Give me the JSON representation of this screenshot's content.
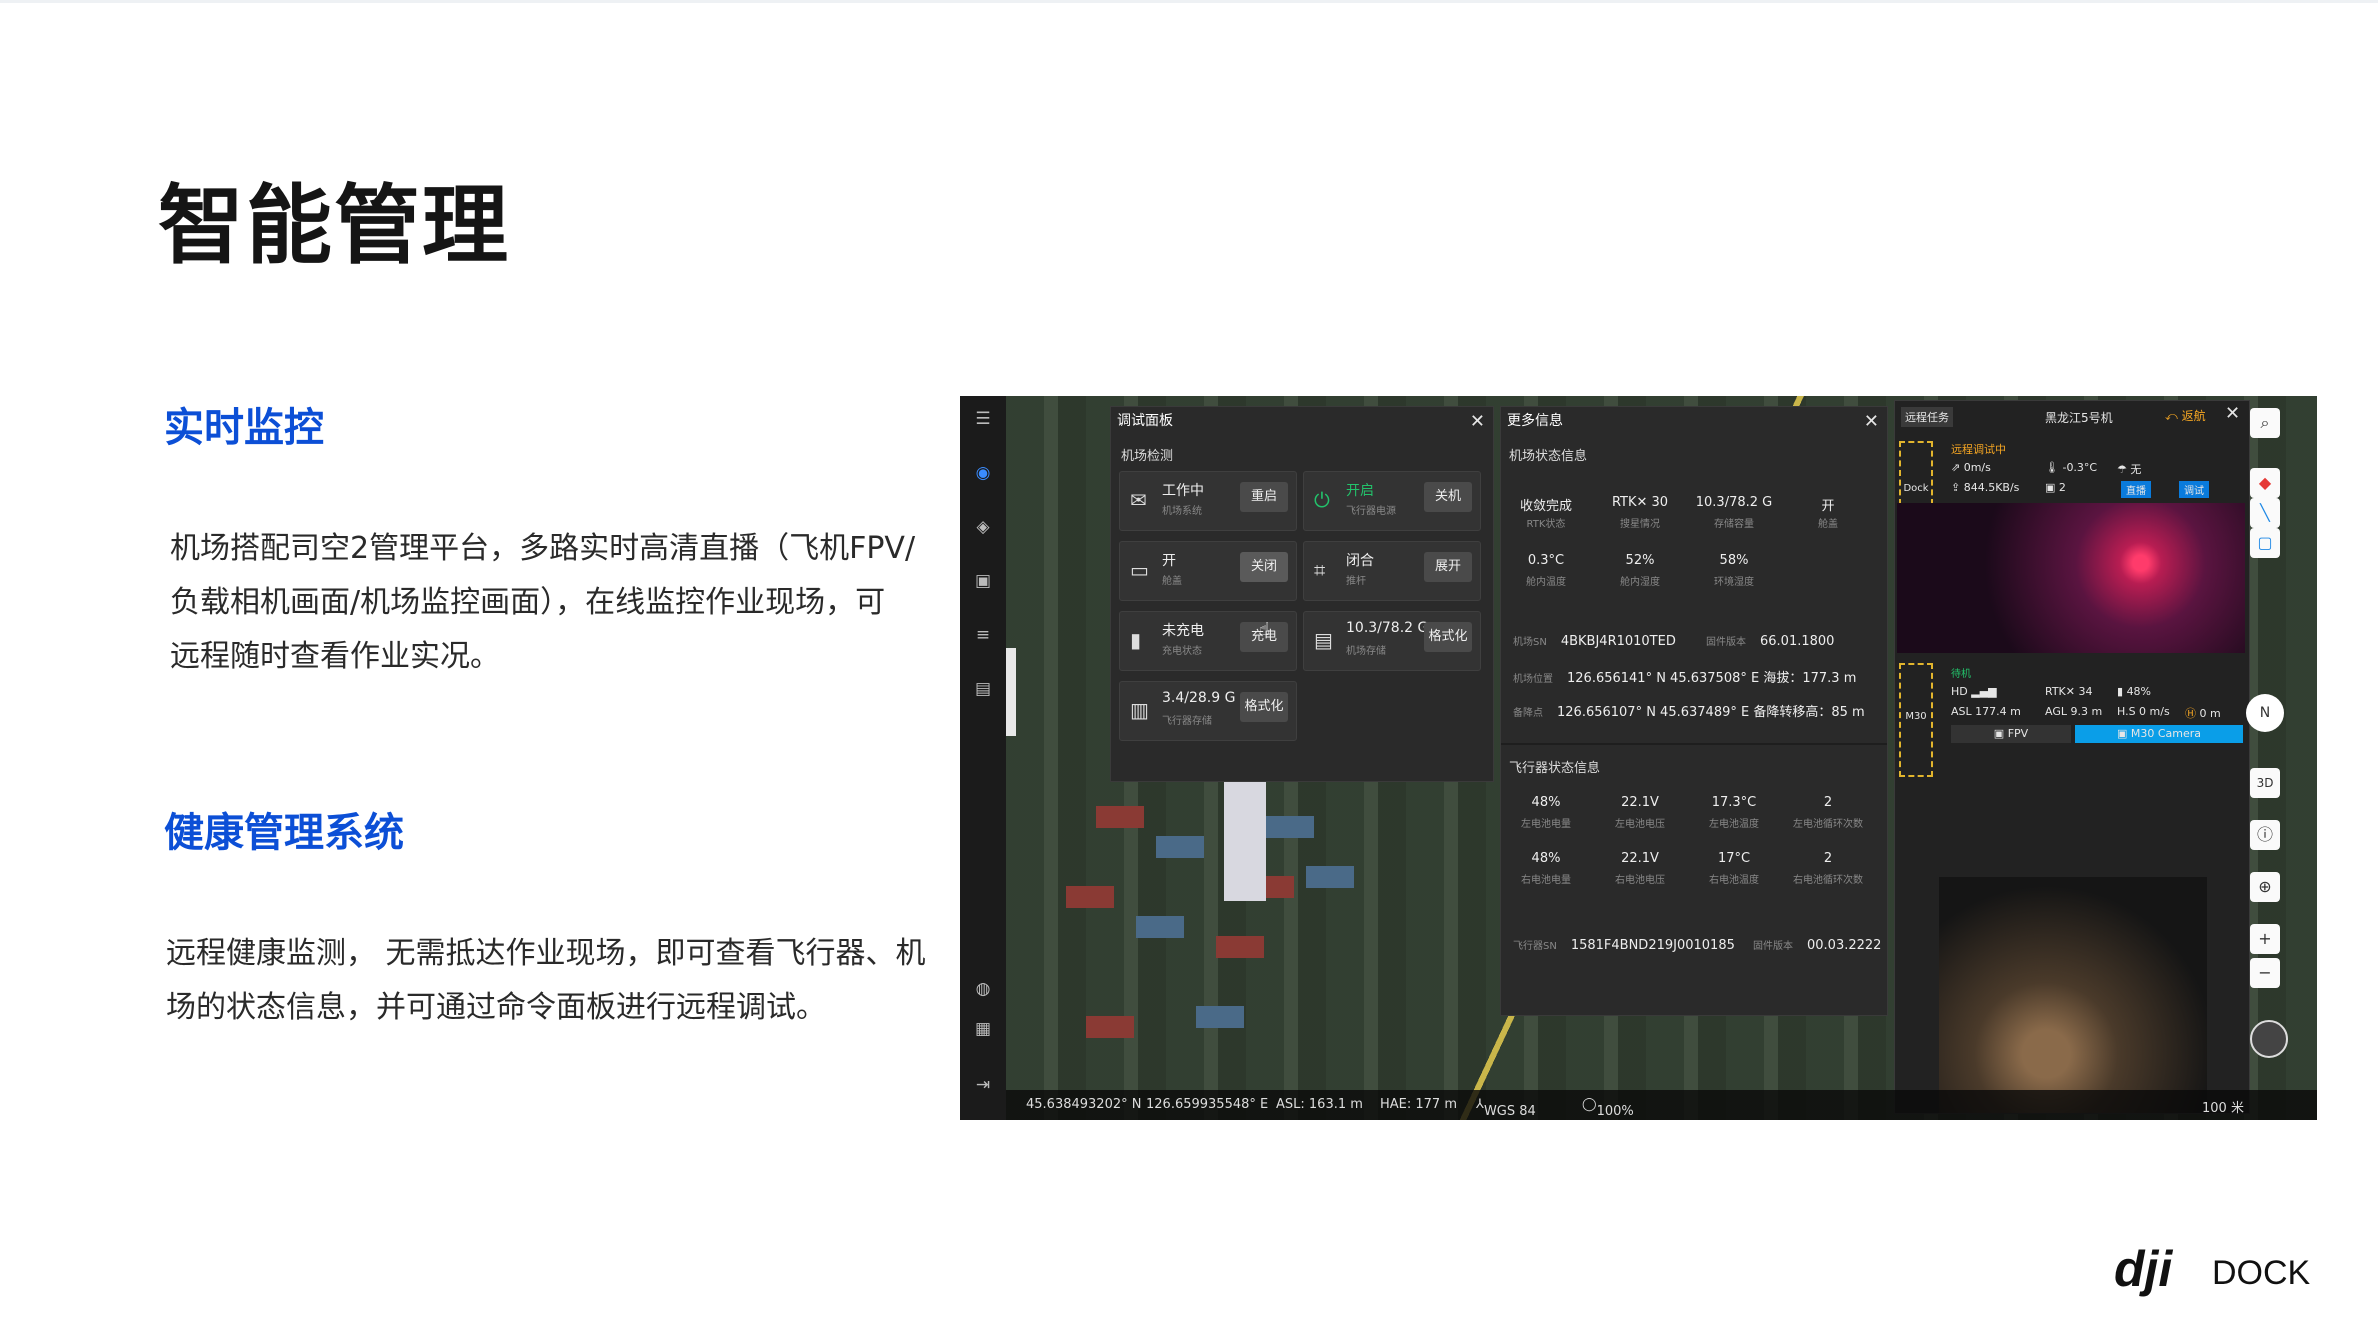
{
  "slide": {
    "title": "智能管理",
    "section1": {
      "heading": "实时监控",
      "lines": [
        "机场搭配司空2管理平台，多路实时高清直播（飞机FPV/",
        "负载相机画面/机场监控画面），在线监控作业现场，可",
        "远程随时查看作业实况。"
      ]
    },
    "section2": {
      "heading": "健康管理系统",
      "lines": [
        "远程健康监测， 无需抵达作业现场，即可查看飞行器、机",
        "场的状态信息，并可通过命令面板进行远程调试。"
      ]
    },
    "logo": {
      "brand": "dji",
      "product": "DOCK"
    }
  },
  "app": {
    "debug_panel": {
      "title": "调试面板",
      "section": "机场检测",
      "cells": [
        {
          "value": "工作中",
          "sub": "机场系统",
          "button": "重启",
          "icon": "mail-icon"
        },
        {
          "value": "开启",
          "sub": "飞行器电源",
          "button": "关机",
          "icon": "power-icon"
        },
        {
          "value": "开",
          "sub": "舱盖",
          "button": "关闭",
          "icon": "cover-icon"
        },
        {
          "value": "闭合",
          "sub": "推杆",
          "button": "展开",
          "icon": "putter-icon"
        },
        {
          "value": "未充电",
          "sub": "充电状态",
          "button": "充电",
          "icon": "battery-icon"
        },
        {
          "value": "10.3/78.2 G",
          "sub": "机场存储",
          "button": "格式化",
          "icon": "storage-icon"
        },
        {
          "value": "3.4/28.9 G",
          "sub": "飞行器存储",
          "button": "格式化",
          "icon": "aircraft-storage-icon"
        }
      ]
    },
    "more_info": {
      "title": "更多信息",
      "dock_section": "机场状态信息",
      "dock_values": [
        {
          "v": "收敛完成",
          "l": "RTK状态"
        },
        {
          "v": "RTK✕ 30",
          "l": "搜星情况"
        },
        {
          "v": "10.3/78.2 G",
          "l": "存储容量"
        },
        {
          "v": "开",
          "l": "舱盖"
        },
        {
          "v": "0.3°C",
          "l": "舱内温度"
        },
        {
          "v": "52%",
          "l": "舱内湿度"
        },
        {
          "v": "58%",
          "l": "环境湿度"
        }
      ],
      "dock_sn_label": "机场SN",
      "dock_sn": "4BKBJ4R1010TED",
      "fw_label": "固件版本",
      "fw": "66.01.1800",
      "pos_label": "机场位置",
      "pos": "126.656141° N  45.637508° E  海拔：177.3 m",
      "alt_label": "备降点",
      "alt": "126.656107° N  45.637489° E  备降转移高：85 m",
      "aircraft_section": "飞行器状态信息",
      "aircraft_values": [
        {
          "v": "48%",
          "l": "左电池电量"
        },
        {
          "v": "22.1V",
          "l": "左电池电压"
        },
        {
          "v": "17.3°C",
          "l": "左电池温度"
        },
        {
          "v": "2",
          "l": "左电池循环次数"
        },
        {
          "v": "48%",
          "l": "右电池电量"
        },
        {
          "v": "22.1V",
          "l": "右电池电压"
        },
        {
          "v": "17°C",
          "l": "右电池温度"
        },
        {
          "v": "2",
          "l": "右电池循环次数"
        }
      ],
      "aircraft_sn_label": "飞行器SN",
      "aircraft_sn": "1581F4BND219J0010185",
      "aircraft_fw_label": "固件版本",
      "aircraft_fw": "00.03.2222"
    },
    "live": {
      "tab": "远程任务",
      "device": "黑龙江5号机",
      "return": "返航",
      "dock_label": "Dock",
      "status": "远程调试中",
      "speed": "0m/s",
      "temp": "-0.3°C",
      "wind": "无",
      "rate": "844.5KB/s",
      "count": "2",
      "btn_live": "直播",
      "btn_debug": "调试",
      "m30_label": "M30",
      "m30_status": "待机",
      "hd": "HD",
      "rtk": "RTK✕ 34",
      "battery": "48%",
      "asl": "ASL 177.4 m",
      "agl": "AGL 9.3 m",
      "hs": "H.S 0 m/s",
      "home": "0 m",
      "fpv": "FPV",
      "camera": "M30 Camera"
    },
    "status_bar": {
      "lat": "45.638493202° N",
      "lon": "126.659935548° E",
      "asl": "ASL: 163.1 m",
      "hae": "HAE: 177 m",
      "datum": "WGS 84",
      "battery": "100%",
      "scale": "100 米"
    },
    "right_tools": [
      "search-icon",
      "pin-icon",
      "line-icon",
      "polygon-icon",
      "compass-icon",
      "3d-label",
      "info-icon",
      "locate-icon",
      "zoom-in-icon",
      "zoom-out-icon",
      "globe-icon"
    ],
    "compass_n": "N",
    "btn_3d": "3D"
  }
}
